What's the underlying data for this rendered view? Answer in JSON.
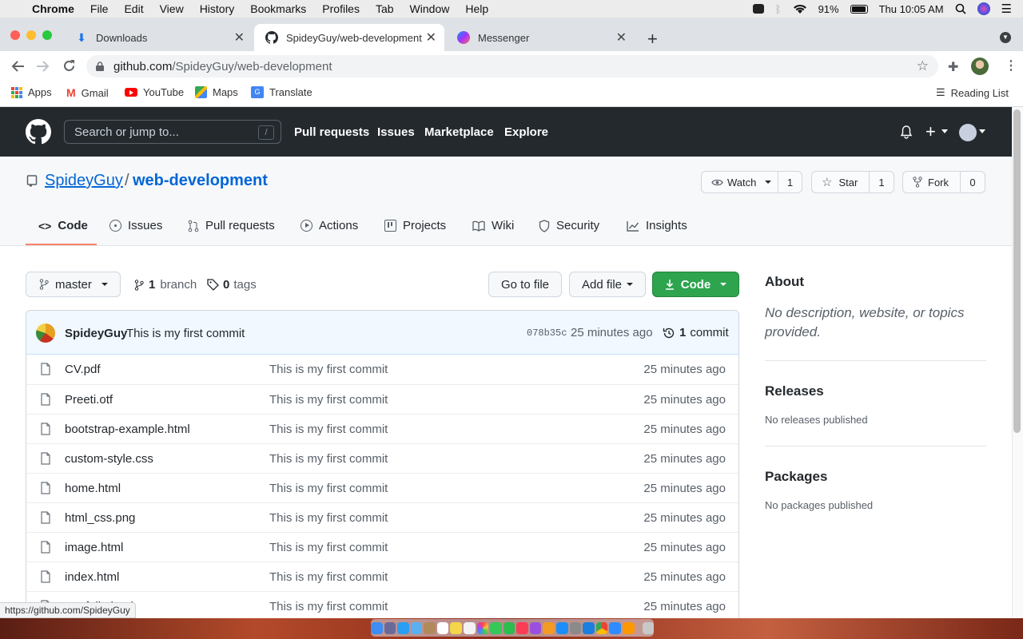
{
  "menubar": {
    "app": "Chrome",
    "items": [
      "File",
      "Edit",
      "View",
      "History",
      "Bookmarks",
      "Profiles",
      "Tab",
      "Window",
      "Help"
    ],
    "battery": "91%",
    "clock": "Thu 10:05 AM"
  },
  "tabs": [
    {
      "title": "Downloads",
      "icon": "download-icon"
    },
    {
      "title": "SpideyGuy/web-development",
      "icon": "github-icon"
    },
    {
      "title": "Messenger",
      "icon": "messenger-icon"
    }
  ],
  "address": {
    "host": "github.com",
    "path": "/SpideyGuy/web-development"
  },
  "bookmarks": {
    "items": [
      "Apps",
      "Gmail",
      "YouTube",
      "Maps",
      "Translate"
    ],
    "reading_list": "Reading List"
  },
  "github": {
    "search_placeholder": "Search or jump to...",
    "search_key": "/",
    "nav": [
      "Pull requests",
      "Issues",
      "Marketplace",
      "Explore"
    ]
  },
  "repo": {
    "owner": "SpideyGuy",
    "separator": "/",
    "name": "web-development",
    "watch_label": "Watch",
    "watch_count": "1",
    "star_label": "Star",
    "star_count": "1",
    "fork_label": "Fork",
    "fork_count": "0",
    "tabs": [
      "Code",
      "Issues",
      "Pull requests",
      "Actions",
      "Projects",
      "Wiki",
      "Security",
      "Insights"
    ]
  },
  "branchbar": {
    "branch": "master",
    "branch_count": "1",
    "branch_word": "branch",
    "tag_count": "0",
    "tag_word": "tags",
    "goto_file": "Go to file",
    "add_file": "Add file",
    "code": "Code"
  },
  "commit": {
    "author": "SpideyGuy",
    "message": "This is my first commit",
    "sha": "078b35c",
    "time": "25 minutes ago",
    "count": "1",
    "count_word": "commit"
  },
  "files": [
    {
      "name": "CV.pdf",
      "message": "This is my first commit",
      "time": "25 minutes ago"
    },
    {
      "name": "Preeti.otf",
      "message": "This is my first commit",
      "time": "25 minutes ago"
    },
    {
      "name": "bootstrap-example.html",
      "message": "This is my first commit",
      "time": "25 minutes ago"
    },
    {
      "name": "custom-style.css",
      "message": "This is my first commit",
      "time": "25 minutes ago"
    },
    {
      "name": "home.html",
      "message": "This is my first commit",
      "time": "25 minutes ago"
    },
    {
      "name": "html_css.png",
      "message": "This is my first commit",
      "time": "25 minutes ago"
    },
    {
      "name": "image.html",
      "message": "This is my first commit",
      "time": "25 minutes ago"
    },
    {
      "name": "index.html",
      "message": "This is my first commit",
      "time": "25 minutes ago"
    },
    {
      "name": "portfolio.html",
      "message": "This is my first commit",
      "time": "25 minutes ago"
    }
  ],
  "about": {
    "title": "About",
    "description": "No description, website, or topics provided.",
    "releases_title": "Releases",
    "releases_text": "No releases published",
    "packages_title": "Packages",
    "packages_text": "No packages published"
  },
  "status_url": "https://github.com/SpideyGuy",
  "colors": {
    "github_dark": "#24292e",
    "link_blue": "#0366d6",
    "green": "#2ea44f",
    "tab_underline": "#f9826c"
  }
}
